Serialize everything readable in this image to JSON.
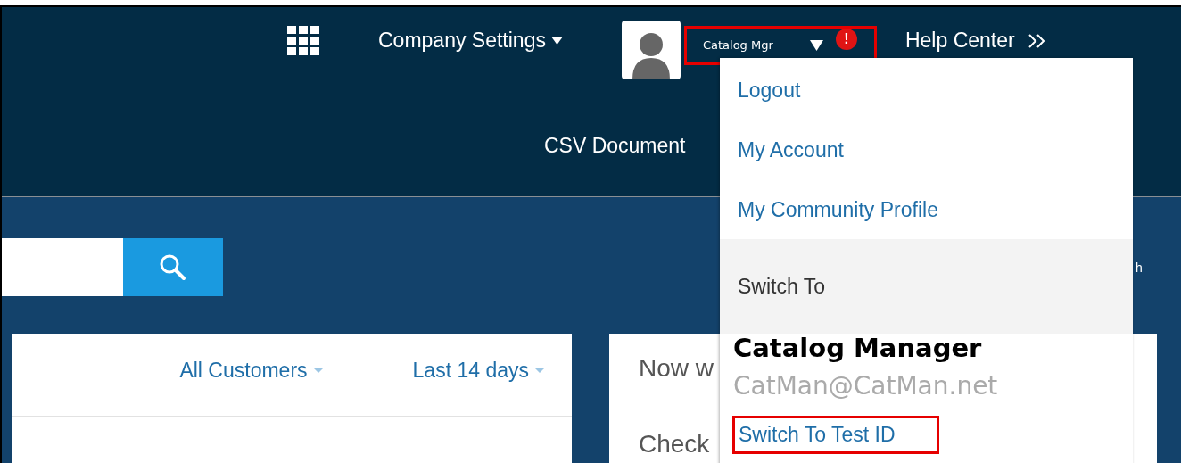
{
  "header": {
    "nav": [
      {
        "label": "Company Settings",
        "has_menu": true
      }
    ],
    "user_menu": {
      "label": "Catalog Mgr",
      "alert": "!",
      "open": true
    },
    "help": {
      "label": "Help Center"
    },
    "subnav": [
      {
        "label": "CSV Document"
      }
    ]
  },
  "filters": [
    {
      "label": "All Customers"
    },
    {
      "label": "Last 14 days"
    }
  ],
  "side_text": "h",
  "right_card": {
    "lines": [
      "Now w",
      "Check"
    ]
  },
  "dropdown": {
    "items": [
      {
        "label": "Logout"
      },
      {
        "label": "My Account"
      },
      {
        "label": "My Community Profile"
      }
    ],
    "section": "Switch To",
    "account": {
      "name": "Catalog Manager",
      "email": "CatMan@CatMan.net",
      "action": "Switch To Test ID"
    }
  }
}
